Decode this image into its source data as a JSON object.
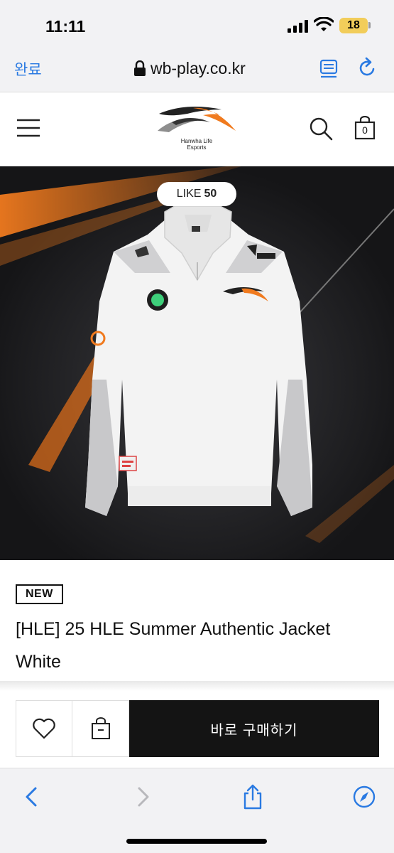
{
  "status_bar": {
    "time": "11:11",
    "battery": "18",
    "battery_color": "#f2cd5a"
  },
  "browser": {
    "done_label": "완료",
    "url": "wb-play.co.kr",
    "accent_color": "#2a7ae2",
    "icons": [
      "lock-icon",
      "reader-icon",
      "reload-icon",
      "back-icon",
      "forward-icon",
      "share-icon",
      "compass-icon"
    ]
  },
  "header": {
    "logo_text_line1": "Hanwha Life",
    "logo_text_line2": "Esports",
    "cart_count": "0",
    "brand_color": "#f07a1e"
  },
  "product": {
    "like_label": "LIKE",
    "like_count": "50",
    "badge": "NEW",
    "title": "[HLE] 25 HLE Summer Authentic Jacket White"
  },
  "actions": {
    "buy_label": "바로 구매하기"
  }
}
